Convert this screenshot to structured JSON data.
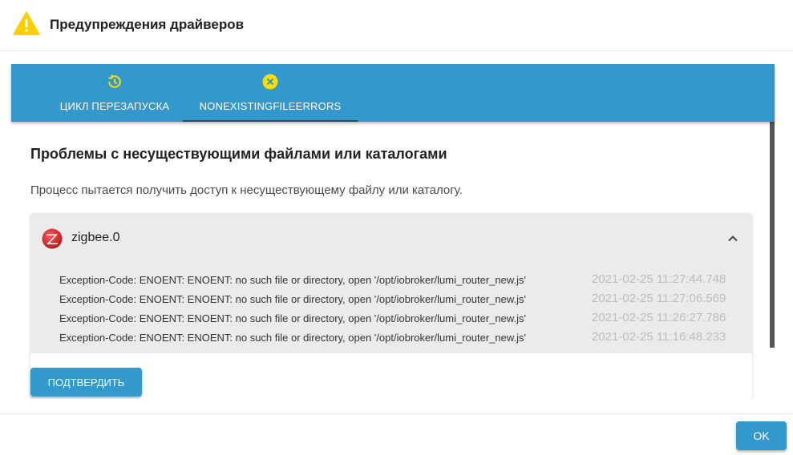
{
  "dialog": {
    "title": "Предупреждения драйверов",
    "title_icon": "warning-icon",
    "ok_label": "OK"
  },
  "tabs": [
    {
      "label": "ЦИКЛ ПЕРЕЗАПУСКА",
      "icon": "restart-clock-icon",
      "active": false
    },
    {
      "label": "NONEXISTINGFILEERRORS",
      "icon": "close-circle-icon",
      "active": true
    }
  ],
  "section": {
    "title": "Проблемы с несуществующими файлами или каталогами",
    "description": "Процесс пытается получить доступ к несуществующему файлу или каталогу."
  },
  "adapter": {
    "name": "zigbee.0",
    "icon": "zigbee-logo-icon",
    "expanded": true
  },
  "messages": [
    {
      "text": "Exception-Code: ENOENT: ENOENT: no such file or directory, open '/opt/iobroker/lumi_router_new.js'",
      "time": "2021-02-25 11:27:44.748"
    },
    {
      "text": "Exception-Code: ENOENT: ENOENT: no such file or directory, open '/opt/iobroker/lumi_router_new.js'",
      "time": "2021-02-25 11:27:06.569"
    },
    {
      "text": "Exception-Code: ENOENT: ENOENT: no such file or directory, open '/opt/iobroker/lumi_router_new.js'",
      "time": "2021-02-25 11:26:27.786"
    },
    {
      "text": "Exception-Code: ENOENT: ENOENT: no such file or directory, open '/opt/iobroker/lumi_router_new.js'",
      "time": "2021-02-25 11:16:48.233"
    }
  ],
  "confirm_label": "Подтвердить",
  "colors": {
    "primary": "#3399cc",
    "warning": "#ffcc00",
    "tab_icon": "#ffdd00",
    "zigbee": "#d8262e"
  }
}
